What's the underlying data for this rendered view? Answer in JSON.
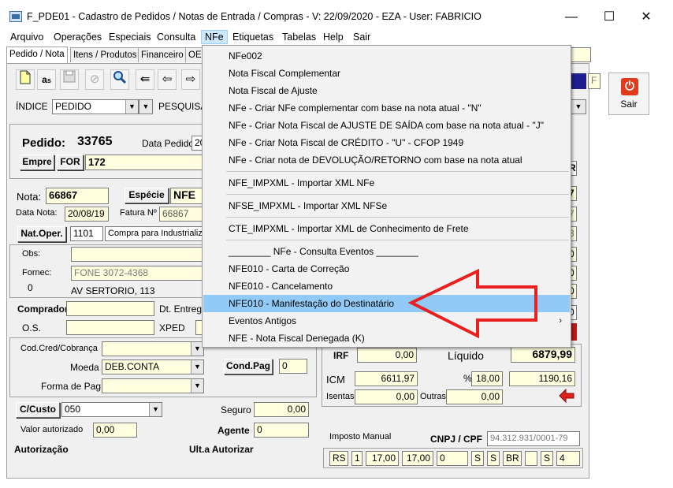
{
  "window": {
    "title": "F_PDE01 - Cadastro de Pedidos / Notas de Entrada / Compras - V: 22/09/2020 - EZA - User: FABRICIO",
    "minimize": "—",
    "maximize": "☐",
    "close": "✕"
  },
  "menubar": [
    "Arquivo",
    "Operações",
    "Especiais",
    "Consulta",
    "NFe",
    "Etiquetas",
    "Tabelas",
    "Help",
    "Sair"
  ],
  "tabs": [
    "Pedido / Nota",
    "Itens / Produtos",
    "Financeiro",
    "OE"
  ],
  "toolbar": {
    "icons": [
      "new-document-icon",
      "edit-icon",
      "save-icon",
      "cancel-icon",
      "search-icon",
      "first-icon",
      "prev-icon",
      "next-icon"
    ]
  },
  "index": {
    "label": "ÍNDICE",
    "value": "PEDIDO",
    "search_label": "PESQUISA"
  },
  "right_top": {
    "code": "F"
  },
  "sair_button": {
    "label": "Sair"
  },
  "pedido": {
    "label": "Pedido:",
    "value": "33765",
    "data_label": "Data Pedido",
    "data_value": "20",
    "empre_label": "Empre",
    "for_label": "FOR",
    "for_value": "172"
  },
  "nota": {
    "label": "Nota:",
    "value": "66867",
    "especie_label": "Espécie",
    "especie_value": "NFE",
    "data_nota_label": "Data Nota:",
    "data_nota_value": "20/08/19",
    "fatura_label": "Fatura Nº",
    "fatura_value": "66867"
  },
  "natoper": {
    "label": "Nat.Oper.",
    "code": "1101",
    "desc": "Compra para Industrializa"
  },
  "obs": {
    "label": "Obs:",
    "value": ""
  },
  "fornec": {
    "label": "Fornec:",
    "phone": "FONE 3072-4368",
    "num": "0",
    "address": "AV SERTORIO, 113"
  },
  "comprador": {
    "label": "Comprador",
    "dt_entrega_label": "Dt. Entrega",
    "os_label": "O.S.",
    "xped_label": "XPED"
  },
  "cobranca": {
    "cod_label": "Cod.Cred/Cobrança",
    "moeda_label": "Moeda",
    "moeda_value": "DEB.CONTA",
    "condpag_label": "Cond.Pag",
    "condpag_value": "0",
    "forma_label": "Forma de Pag."
  },
  "custo": {
    "label": "C/Custo",
    "value": "050",
    "seguro_label": "Seguro",
    "seguro_value": "0,00"
  },
  "valor": {
    "label": "Valor autorizado",
    "value": "0,00",
    "agente_label": "Agente",
    "agente_value": "0"
  },
  "autorizacao": {
    "label": "Autorização",
    "ult_label": "Ult.a Autorizar"
  },
  "totais": {
    "irf_label": "IRF",
    "irf_value": "0,00",
    "liquido_label": "Líquido",
    "liquido_value": "6879,99",
    "icm_label": "ICM",
    "icm_base": "6611,97",
    "pct_label": "%",
    "pct_value": "18,00",
    "icm_value": "1190,16",
    "isentas_label": "Isentas",
    "isentas_value": "0,00",
    "outras_label": "Outras",
    "outras_value": "0,00"
  },
  "imposto": {
    "label": "Imposto Manual",
    "cnpj_label": "CNPJ / CPF",
    "cnpj_value": "94.312.931/0001-79",
    "fields": [
      "RS",
      "1",
      "17,00",
      "17,00",
      "0",
      "S",
      "S",
      "BR",
      "",
      "S",
      "4"
    ]
  },
  "right_side": [
    "R",
    "7",
    "7",
    "3",
    "0",
    "0",
    "0",
    "0"
  ],
  "nfe_menu": {
    "items": [
      "NFe002",
      "Nota Fiscal Complementar",
      "Nota Fiscal de Ajuste",
      "NFe - Criar NFe complementar com base na nota atual - \"N\"",
      "NFe - Criar Nota Fiscal de AJUSTE DE SAÍDA com base na nota atual - \"J\"",
      "NFe - Criar Nota Fiscal de CRÉDITO - \"U\" - CFOP 1949",
      "NFe - Criar nota de DEVOLUÇÃO/RETORNO com base na nota atual",
      "NFE_IMPXML - Importar XML NFe",
      "NFSE_IMPXML - Importar XML NFSe",
      "CTE_IMPXML - Importar XML de Conhecimento de Frete",
      "________ NFe - Consulta Eventos ________",
      "NFE010 - Carta de Correção",
      "NFE010 - Cancelamento",
      "NFE010 - Manifestação do Destinatário",
      "Eventos Antigos",
      "NFE - Nota Fiscal Denegada (K)"
    ],
    "submenu_arrow": "›",
    "highlight_index": 13
  },
  "colors": {
    "highlight": "#91c9f7",
    "arrow": "#e8201f",
    "yellow_field": "#ffffe0"
  }
}
